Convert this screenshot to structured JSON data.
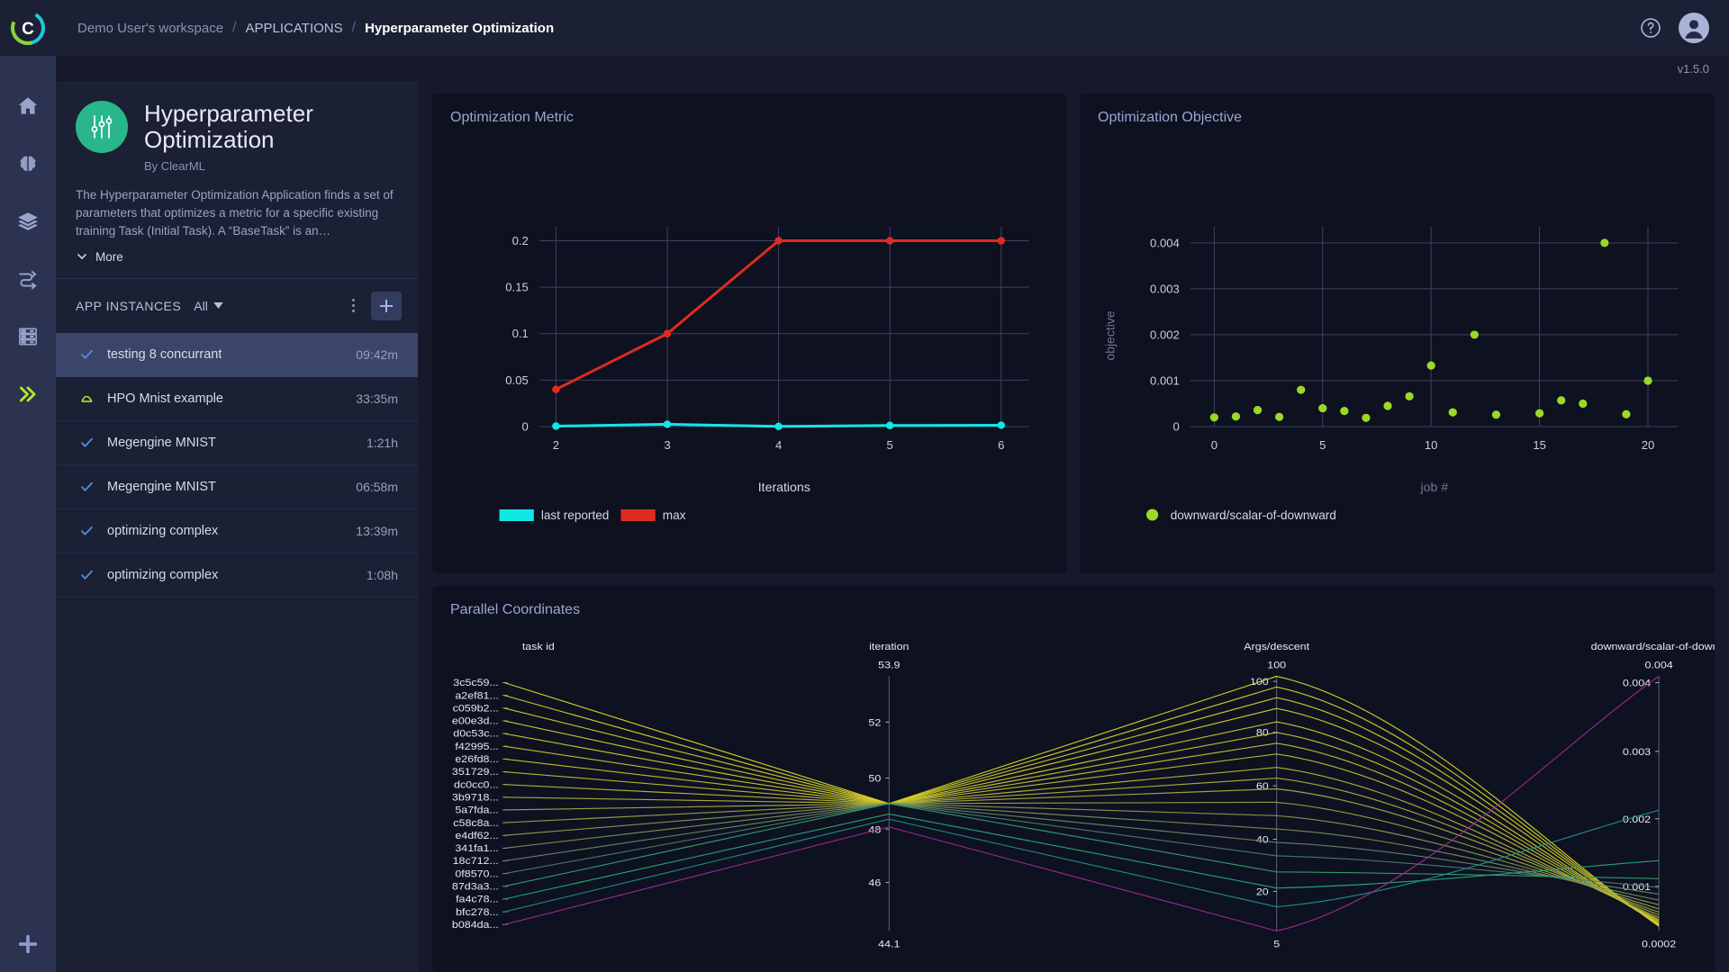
{
  "topbar": {
    "breadcrumbs": [
      {
        "label": "Demo User's workspace",
        "current": false
      },
      {
        "label": "APPLICATIONS",
        "current": false
      },
      {
        "label": "Hyperparameter Optimization",
        "current": true
      }
    ],
    "separator": "/",
    "help_icon": "question-circle-icon",
    "avatar_icon": "user-avatar-icon"
  },
  "version": "v1.5.0",
  "rail": {
    "logo_icon": "clearml-logo-icon",
    "items": [
      {
        "icon": "home-icon",
        "name": "home",
        "active": false
      },
      {
        "icon": "brain-icon",
        "name": "projects",
        "active": false
      },
      {
        "icon": "layers-icon",
        "name": "datasets",
        "active": false
      },
      {
        "icon": "pipelines-icon",
        "name": "pipelines",
        "active": false
      },
      {
        "icon": "server-icon",
        "name": "workers",
        "active": false
      },
      {
        "icon": "double-chevron-right-icon",
        "name": "applications",
        "active": true
      }
    ],
    "bottom_icon": "slack-icon"
  },
  "app_info": {
    "avatar_icon": "sliders-icon",
    "title": "Hyperparameter Optimization",
    "by": "By ClearML",
    "description": "The Hyperparameter Optimization Application finds a set of parameters that optimizes a metric for a specific existing training Task (Initial Task). A “BaseTask” is an…",
    "more_label": "More",
    "more_icon": "chevron-down-icon"
  },
  "instances_header": {
    "title": "APP INSTANCES",
    "filter_value": "All",
    "filter_icon": "caret-down-icon",
    "menu_icon": "kebab-menu-icon",
    "add_icon": "plus-icon"
  },
  "instances": [
    {
      "status": "completed",
      "status_icon": "check-icon",
      "name": "testing 8 concurrant",
      "time": "09:42m",
      "selected": true
    },
    {
      "status": "running",
      "status_icon": "cloud-icon",
      "name": "HPO Mnist example",
      "time": "33:35m",
      "selected": false
    },
    {
      "status": "completed",
      "status_icon": "check-icon",
      "name": "Megengine MNIST",
      "time": "1:21h",
      "selected": false
    },
    {
      "status": "completed",
      "status_icon": "check-icon",
      "name": "Megengine MNIST",
      "time": "06:58m",
      "selected": false
    },
    {
      "status": "completed",
      "status_icon": "check-icon",
      "name": "optimizing complex",
      "time": "13:39m",
      "selected": false
    },
    {
      "status": "completed",
      "status_icon": "check-icon",
      "name": "optimizing complex",
      "time": "1:08h",
      "selected": false
    }
  ],
  "cards": {
    "metric_title": "Optimization Metric",
    "objective_title": "Optimization Objective",
    "parallel_title": "Parallel Coordinates"
  },
  "colors": {
    "accent_green": "#29b68b",
    "series_last_reported": "#12e7e7",
    "series_max": "#e02b20",
    "scatter": "#9bd927",
    "panel_bg": "#0e1120",
    "page_bg": "#16192b",
    "rail_bg": "#2b3350",
    "selected_row": "#3b4469"
  },
  "chart_data": [
    {
      "type": "line",
      "title": "Optimization Metric",
      "xlabel": "Iterations",
      "ylabel": "",
      "x": [
        2,
        3,
        4,
        5,
        6
      ],
      "xticks": [
        "2",
        "3",
        "4",
        "5",
        "6"
      ],
      "yticks": [
        "0",
        "0.05",
        "0.1",
        "0.15",
        "0.2"
      ],
      "ylim": [
        0,
        0.215
      ],
      "xlim": [
        1.85,
        6.25
      ],
      "grid": true,
      "legend_position": "bottom-left",
      "series": [
        {
          "name": "last reported",
          "color": "#12e7e7",
          "values": [
            0.0005,
            0.0025,
            0.0002,
            0.0012,
            0.0015
          ]
        },
        {
          "name": "max",
          "color": "#e02b20",
          "values": [
            0.04,
            0.1,
            0.2,
            0.2,
            0.2
          ]
        }
      ]
    },
    {
      "type": "scatter",
      "title": "Optimization Objective",
      "xlabel": "job #",
      "ylabel": "objective",
      "xticks": [
        "0",
        "5",
        "10",
        "15",
        "20"
      ],
      "yticks": [
        "0",
        "0.001",
        "0.002",
        "0.003",
        "0.004"
      ],
      "xlim": [
        -1.1,
        21.4
      ],
      "ylim": [
        0,
        0.00435
      ],
      "grid": true,
      "legend_position": "bottom-left",
      "series": [
        {
          "name": "downward/scalar-of-downward",
          "color": "#9bd927",
          "x": [
            0,
            1,
            2,
            3,
            4,
            5,
            6,
            7,
            8,
            9,
            10,
            11,
            12,
            13,
            15,
            16,
            17,
            18,
            19,
            20
          ],
          "y": [
            0.0002,
            0.00022,
            0.00036,
            0.00021,
            0.0008,
            0.0004,
            0.00034,
            0.00019,
            0.00045,
            0.00066,
            0.00133,
            0.00031,
            0.002,
            0.00026,
            0.00029,
            0.00057,
            0.0005,
            0.004,
            0.00027,
            0.001
          ]
        }
      ]
    },
    {
      "type": "parallel",
      "title": "Parallel Coordinates",
      "axes": [
        {
          "name": "task id",
          "kind": "category",
          "categories": [
            "3c5c59...",
            "a2ef81...",
            "c059b2...",
            "e00e3d...",
            "d0c53c...",
            "f42995...",
            "e26fd8...",
            "351729...",
            "dc0cc0...",
            "3b9718...",
            "5a7fda...",
            "c58c8a...",
            "e4df62...",
            "341fa1...",
            "18c712...",
            "0f8570...",
            "87d3a3...",
            "fa4c78...",
            "bfc278...",
            "b084da..."
          ]
        },
        {
          "name": "iteration",
          "kind": "numeric",
          "top_label": "53.9",
          "bottom_label": "44.1",
          "ticks": [
            "52",
            "50",
            "48",
            "46"
          ],
          "tick_positions": [
            0.82,
            0.6,
            0.4,
            0.19
          ],
          "range": [
            44.1,
            53.9
          ]
        },
        {
          "name": "Args/descent",
          "kind": "numeric",
          "top_label": "100",
          "bottom_label": "5",
          "ticks": [
            "100",
            "80",
            "60",
            "40",
            "20"
          ],
          "tick_positions": [
            0.98,
            0.78,
            0.57,
            0.36,
            0.155
          ],
          "range": [
            5,
            100
          ]
        },
        {
          "name": "downward/scalar-of-downw",
          "kind": "numeric",
          "top_label": "0.004",
          "bottom_label": "0.0002",
          "ticks": [
            "0.004",
            "0.003",
            "0.002",
            "0.001"
          ],
          "tick_positions": [
            0.975,
            0.705,
            0.44,
            0.175
          ],
          "range": [
            0.0002,
            0.004
          ]
        }
      ],
      "lines": [
        {
          "task": "3c5c59...",
          "iteration": 49.0,
          "descent": 100,
          "objective": 0.00027,
          "color": "#d6d425"
        },
        {
          "task": "a2ef81...",
          "iteration": 49.0,
          "descent": 96,
          "objective": 0.00028,
          "color": "#d5d226"
        },
        {
          "task": "c059b2...",
          "iteration": 49.0,
          "descent": 92,
          "objective": 0.00029,
          "color": "#d4d027"
        },
        {
          "task": "e00e3d...",
          "iteration": 49.0,
          "descent": 88,
          "objective": 0.0003,
          "color": "#d2cd29"
        },
        {
          "task": "d0c53c...",
          "iteration": 49.0,
          "descent": 83,
          "objective": 0.00031,
          "color": "#cfca2b"
        },
        {
          "task": "f42995...",
          "iteration": 49.0,
          "descent": 79,
          "objective": 0.00033,
          "color": "#cbc62d"
        },
        {
          "task": "e26fd8...",
          "iteration": 49.0,
          "descent": 75,
          "objective": 0.00035,
          "color": "#c6c230"
        },
        {
          "task": "351729...",
          "iteration": 49.0,
          "descent": 71,
          "objective": 0.00037,
          "color": "#c0bd33"
        },
        {
          "task": "dc0cc0...",
          "iteration": 49.0,
          "descent": 66,
          "objective": 0.0004,
          "color": "#b9b736"
        },
        {
          "task": "3b9718...",
          "iteration": 49.0,
          "descent": 62,
          "objective": 0.00044,
          "color": "#b0b13b"
        },
        {
          "task": "5a7fda...",
          "iteration": 49.0,
          "descent": 58,
          "objective": 0.00048,
          "color": "#a6aa40"
        },
        {
          "task": "c58c8a...",
          "iteration": 49.0,
          "descent": 53,
          "objective": 0.00053,
          "color": "#99a247"
        },
        {
          "task": "e4df62...",
          "iteration": 49.0,
          "descent": 48,
          "objective": 0.00059,
          "color": "#8a9a4e"
        },
        {
          "task": "341fa1...",
          "iteration": 49.0,
          "descent": 43,
          "objective": 0.00066,
          "color": "#789157"
        },
        {
          "task": "18c712...",
          "iteration": 49.0,
          "descent": 38,
          "objective": 0.00075,
          "color": "#648862"
        },
        {
          "task": "0f8570...",
          "iteration": 49.0,
          "descent": 33,
          "objective": 0.00085,
          "color": "#4c7e6d"
        },
        {
          "task": "87d3a3...",
          "iteration": 49.0,
          "descent": 27,
          "objective": 0.00098,
          "color": "#33a06c"
        },
        {
          "task": "fa4c78...",
          "iteration": 48.6,
          "descent": 21,
          "objective": 0.00125,
          "color": "#26a97b"
        },
        {
          "task": "bfc278...",
          "iteration": 48.4,
          "descent": 14,
          "objective": 0.002,
          "color": "#1e8e8e"
        },
        {
          "task": "b084da...",
          "iteration": 48.1,
          "descent": 5,
          "objective": 0.004,
          "color": "#9c2b8f"
        }
      ]
    }
  ]
}
